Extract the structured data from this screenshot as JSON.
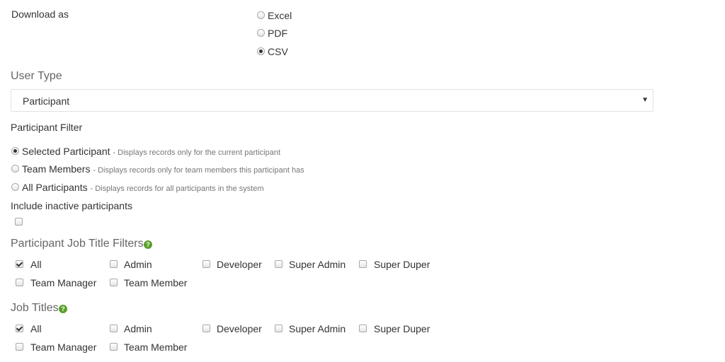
{
  "download": {
    "label": "Download as",
    "options": [
      {
        "label": "Excel",
        "checked": false
      },
      {
        "label": "PDF",
        "checked": false
      },
      {
        "label": "CSV",
        "checked": true
      }
    ]
  },
  "user_type": {
    "label": "User Type",
    "selected": "Participant"
  },
  "participant_filter": {
    "label": "Participant Filter",
    "options": [
      {
        "label": "Selected Participant",
        "desc": "- Displays records only for the current participant",
        "checked": true
      },
      {
        "label": "Team Members",
        "desc": "- Displays records only for team members this participant has",
        "checked": false
      },
      {
        "label": "All Participants",
        "desc": "- Displays records for all participants in the system",
        "checked": false
      }
    ]
  },
  "inactive": {
    "label": "Include inactive participants",
    "checked": false
  },
  "job_title_filters": {
    "label": "Participant Job Title Filters",
    "items": [
      {
        "label": "All",
        "checked": true
      },
      {
        "label": "Admin",
        "checked": false
      },
      {
        "label": "Developer",
        "checked": false
      },
      {
        "label": "Super Admin",
        "checked": false
      },
      {
        "label": "Super Duper",
        "checked": false
      },
      {
        "label": "Team Manager",
        "checked": false
      },
      {
        "label": "Team Member",
        "checked": false
      }
    ]
  },
  "job_titles": {
    "label": "Job Titles",
    "items": [
      {
        "label": "All",
        "checked": true
      },
      {
        "label": "Admin",
        "checked": false
      },
      {
        "label": "Developer",
        "checked": false
      },
      {
        "label": "Super Admin",
        "checked": false
      },
      {
        "label": "Super Duper",
        "checked": false
      },
      {
        "label": "Team Manager",
        "checked": false
      },
      {
        "label": "Team Member",
        "checked": false
      }
    ]
  },
  "help_glyph": "?"
}
